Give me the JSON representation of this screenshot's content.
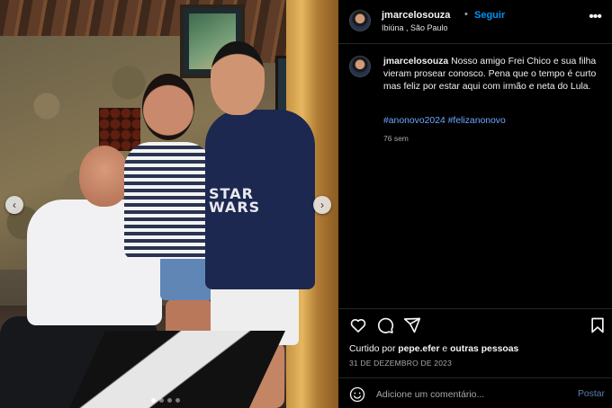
{
  "post": {
    "username": "jmarcelosouza",
    "separator": "•",
    "follow_label": "Seguir",
    "location": "Ibiúna , São Paulo",
    "more_icon": "more-horizontal-icon",
    "more_glyph": "•••",
    "caption_username": "jmarcelosouza",
    "caption_text": " Nosso amigo Frei Chico e sua filha vieram prosear conosco. Pena que o tempo é curto mas feliz por estar aqui com irmão e neta do Lula.",
    "hashtags": [
      "#anonovo2024",
      "#felizanonovo"
    ],
    "caption_age": "76 sem"
  },
  "photo": {
    "shirt_print": "STAR WARS",
    "prev_glyph": "‹",
    "next_glyph": "›",
    "carousel_dots": 4,
    "active_dot": 0
  },
  "actions": {
    "like_icon": "heart-icon",
    "comment_icon": "comment-icon",
    "share_icon": "send-icon",
    "save_icon": "bookmark-icon"
  },
  "likes": {
    "prefix": "Curtido por ",
    "user": "pepe.efer",
    "suffix": " e ",
    "others": "outras pessoas"
  },
  "date": "31 DE DEZEMBRO DE 2023",
  "comment": {
    "emoji_icon": "emoji-icon",
    "placeholder": "Adicione um comentário...",
    "post_label": "Postar"
  },
  "colors": {
    "accent": "#0095f6",
    "hashtag": "#6ea8ff",
    "background": "#000000",
    "muted": "#a8a8a8"
  }
}
